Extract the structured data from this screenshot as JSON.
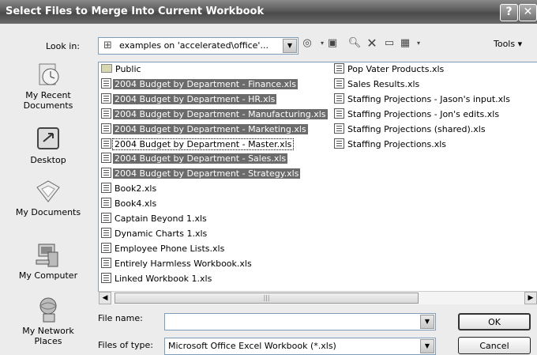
{
  "window": {
    "title": "Select Files to Merge Into Current Workbook",
    "help_btn": "?",
    "close_btn": "✕"
  },
  "lookin": {
    "label": "Look in:",
    "value": "examples on 'accelerated\\office'..."
  },
  "toolbar": {
    "tools_label": "Tools",
    "icons": [
      "back-icon",
      "up-folder-icon",
      "search-web-icon",
      "delete-icon",
      "new-folder-icon",
      "views-icon"
    ]
  },
  "places": [
    {
      "label": "My Recent Documents",
      "icon": "clock-icon"
    },
    {
      "label": "Desktop",
      "icon": "desktop-icon"
    },
    {
      "label": "My Documents",
      "icon": "folder-icon"
    },
    {
      "label": "My Computer",
      "icon": "computer-icon"
    },
    {
      "label": "My Network Places",
      "icon": "network-icon"
    }
  ],
  "files_col1": [
    {
      "name": "Public",
      "type": "folder",
      "selected": false
    },
    {
      "name": "2004 Budget by Department - Finance.xls",
      "type": "xls",
      "selected": true
    },
    {
      "name": "2004 Budget by Department - HR.xls",
      "type": "xls",
      "selected": true
    },
    {
      "name": "2004 Budget by Department - Manufacturing.xls",
      "type": "xls",
      "selected": true
    },
    {
      "name": "2004 Budget by Department - Marketing.xls",
      "type": "xls",
      "selected": true
    },
    {
      "name": "2004 Budget by Department - Master.xls",
      "type": "xls",
      "selected": false,
      "focus": true
    },
    {
      "name": "2004 Budget by Department - Sales.xls",
      "type": "xls",
      "selected": true
    },
    {
      "name": "2004 Budget by Department - Strategy.xls",
      "type": "xls",
      "selected": true
    },
    {
      "name": "Book2.xls",
      "type": "xls",
      "selected": false
    },
    {
      "name": "Book4.xls",
      "type": "xls",
      "selected": false
    },
    {
      "name": "Captain Beyond 1.xls",
      "type": "xls",
      "selected": false
    },
    {
      "name": "Dynamic Charts 1.xls",
      "type": "xls",
      "selected": false
    },
    {
      "name": "Employee Phone Lists.xls",
      "type": "xls",
      "selected": false
    },
    {
      "name": "Entirely Harmless Workbook.xls",
      "type": "xls",
      "selected": false
    },
    {
      "name": "Linked Workbook 1.xls",
      "type": "xls",
      "selected": false
    }
  ],
  "files_col2": [
    {
      "name": "Pop Vater Products.xls",
      "type": "xls",
      "selected": false
    },
    {
      "name": "Sales Results.xls",
      "type": "xls",
      "selected": false
    },
    {
      "name": "Staffing Projections - Jason's input.xls",
      "type": "xls",
      "selected": false
    },
    {
      "name": "Staffing Projections - Jon's edits.xls",
      "type": "xls",
      "selected": false
    },
    {
      "name": "Staffing Projections (shared).xls",
      "type": "xls",
      "selected": false
    },
    {
      "name": "Staffing Projections.xls",
      "type": "xls",
      "selected": false
    }
  ],
  "filename": {
    "label": "File name:",
    "value": ""
  },
  "filetype": {
    "label": "Files of type:",
    "value": "Microsoft Office Excel Workbook (*.xls)"
  },
  "buttons": {
    "ok": "OK",
    "cancel": "Cancel"
  },
  "colors": {
    "selection": "#6b6b6b",
    "titlebar": "#5a5a5a"
  }
}
